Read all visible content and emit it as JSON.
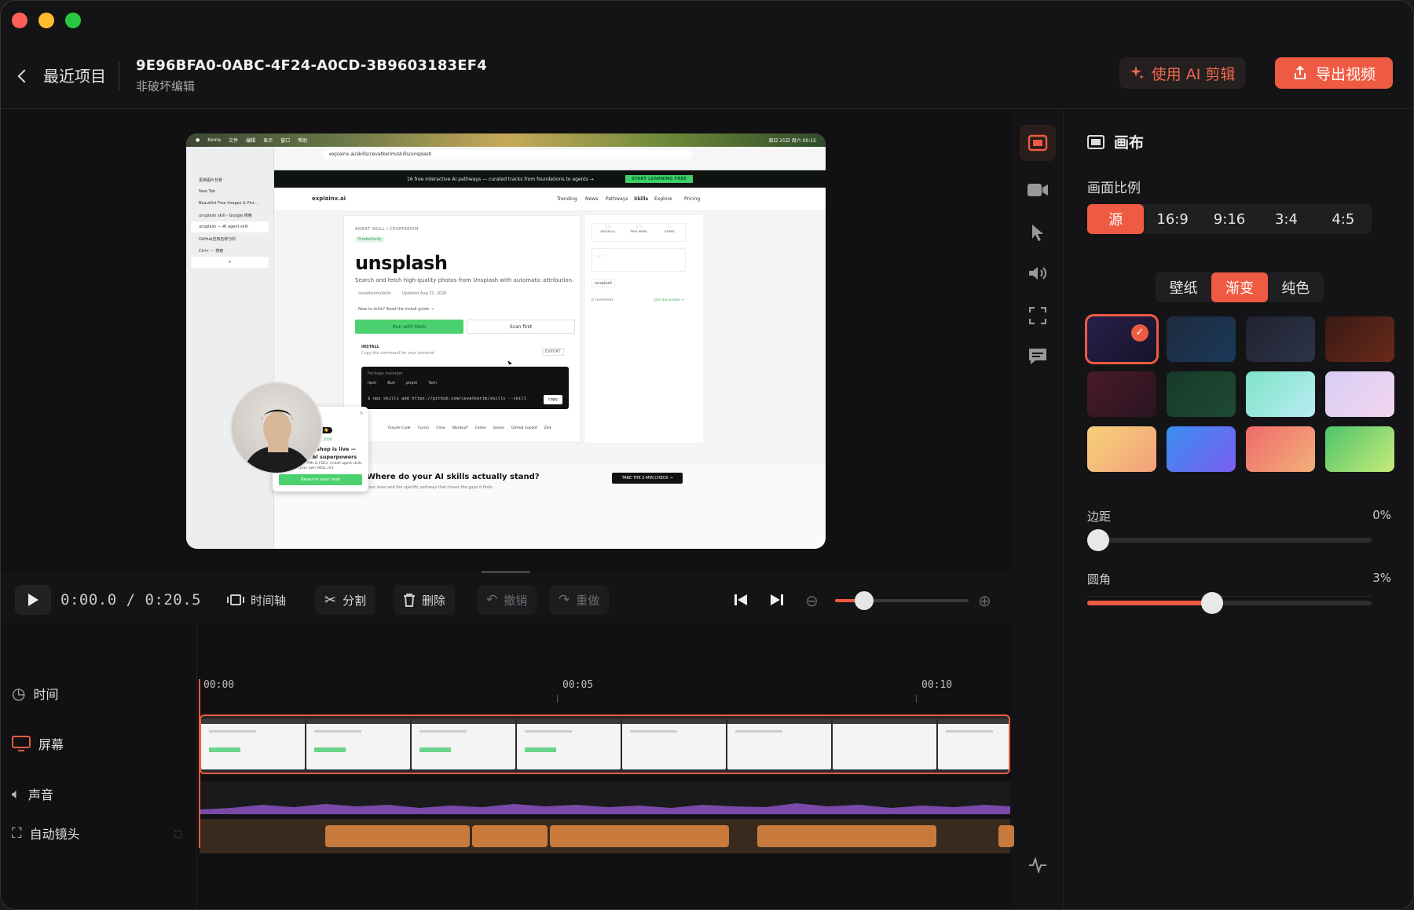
{
  "header": {
    "back_label": "最近项目",
    "project_id": "9E96BFA0-0ABC-4F24-A0CD-3B9603183EF4",
    "subtitle": "非破坏编辑",
    "ai_button": "使用 AI 剪辑",
    "export_button": "导出视频"
  },
  "preview": {
    "menubar_items": [
      "Koma",
      "文件",
      "编辑",
      "显示",
      "窗口",
      "帮助"
    ],
    "menubar_right": "周日 25日 周六 00:15",
    "url": "explainx.ai/skills/cevatkerim/skills/unsplash",
    "tabs": [
      "更换图片背景",
      "New Tab",
      "Beautiful Free Images & Pict...",
      "unsplash skill - Google 搜索",
      "unsplash — AI agent skill",
      "GitHub应用名称分析",
      "Ctrl+ — 搜索"
    ],
    "banner_text": "16 free interactive AI pathways — curated tracks from foundations to agents →",
    "banner_cta": "START LEARNING FREE",
    "site_logo": "explainx.ai",
    "nav_links": [
      "Trending",
      "News",
      "Pathways",
      "Skills",
      "Explore",
      "Pricing"
    ],
    "breadcrumb": "AGENT SKILL / CEVATKERIM",
    "tag": "Productivity",
    "skill_title": "unsplash",
    "skill_desc": "Search and fetch high-quality photos from Unsplash with automatic attribution.",
    "meta_author": "cevatkerim/skills",
    "meta_updated": "Updated Aug 22, 2026",
    "hint": "New to skills? Read the install guide →",
    "run_btn": "Run with Melo",
    "scan_btn": "Scan first",
    "install_label": "INSTALL",
    "install_sub": "Copy the command for your terminal",
    "export_label": "EXPORT",
    "pkg_label": "Package manager",
    "pkg_tabs": [
      "npm",
      "Bun",
      "pnpm",
      "Yarn"
    ],
    "cmd": "$ npx skills add https://github.com/cevatkerim/skills --skill",
    "copy": "copy",
    "stats": [
      {
        "v": "15",
        "l": "INSTALLS"
      },
      {
        "v": "15",
        "l": "THIS WEEK"
      },
      {
        "v": "—",
        "l": "STARS"
      }
    ],
    "vote": "▲ 0",
    "chip": "unsplash",
    "comments": "0 comments",
    "join": "Join discussion →",
    "clients": [
      "Claude Code",
      "Cursor",
      "Cline",
      "Windsurf",
      "Codex",
      "Goose",
      "GitHub Copilot",
      "Zed"
    ],
    "popup_badge": "You live? 👋",
    "popup_date": "SEP 14–16, 2026",
    "popup_line1": "workshop is live — give",
    "popup_line2": "t real superpowers",
    "popup_body": "ers, marketers, PMs & FDEs: install agent skills and author your own SKILL.md",
    "popup_cta": "Reserve your seat",
    "bottom_title": "Where do your AI skills actually stand?",
    "bottom_sub": "your level and the specific pathway that closes the gaps it finds.",
    "bottom_cta": "TAKE THE 2-MIN CHECK →"
  },
  "toolbar": {
    "time": "0:00.0 / 0:20.5",
    "timeline": "时间轴",
    "split": "分割",
    "delete": "删除",
    "undo": "撤销",
    "redo": "重做",
    "zoom_level": 0.22
  },
  "timeline": {
    "tracks": [
      "时间",
      "屏幕",
      "声音",
      "自动镜头"
    ],
    "ruler": [
      "00:00",
      "00:05",
      "00:10"
    ]
  },
  "panel": {
    "title": "画布",
    "ratio_label": "画面比例",
    "ratios": [
      "源",
      "16:9",
      "9:16",
      "3:4",
      "4:5"
    ],
    "ratio_selected": 0,
    "bg_types": [
      "壁纸",
      "渐变",
      "纯色"
    ],
    "bg_selected": 1,
    "check": "✓",
    "swatches": [
      "linear-gradient(135deg,#2a1f4a,#14142a)",
      "linear-gradient(135deg,#1e2a3e,#1a3a5a)",
      "linear-gradient(135deg,#1f2230,#2d3448)",
      "linear-gradient(135deg,#3a1a14,#6a2a1a)",
      "linear-gradient(135deg,#4a1a2a,#2a1420)",
      "linear-gradient(135deg,#173a2a,#1e4a34)",
      "linear-gradient(135deg,#7fe4c8,#b8ecf2)",
      "linear-gradient(135deg,#d8cdf6,#f2d6ee)",
      "linear-gradient(135deg,#f6d27a,#f2a07a)",
      "linear-gradient(135deg,#3a8ef0,#7a5ef0)",
      "linear-gradient(135deg,#ef6a6a,#f2b07a)",
      "linear-gradient(135deg,#4cc36a,#c8ec7a)"
    ],
    "padding_label": "边距",
    "padding_value": "0%",
    "padding_level": 0.0,
    "radius_label": "圆角",
    "radius_value": "3%",
    "radius_level": 0.44
  },
  "colors": {
    "accent": "#ef5b42",
    "traffic_red": "#ff5f57",
    "traffic_yellow": "#febc2e",
    "traffic_green": "#28c840"
  }
}
